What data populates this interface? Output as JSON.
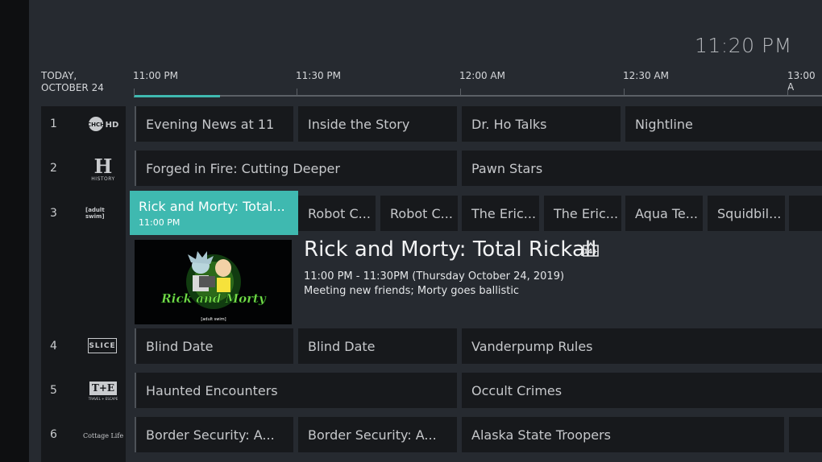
{
  "clock": "11:20 PM",
  "date": {
    "line1": "TODAY,",
    "line2": "OCTOBER 24"
  },
  "times": [
    "11:00 PM",
    "11:30 PM",
    "12:00 AM",
    "12:30 AM",
    "13:00 A"
  ],
  "channels": [
    {
      "number": "1",
      "logo": "CHCH HD",
      "logo_icon": "chch-hd-logo-icon"
    },
    {
      "number": "2",
      "logo": "HISTORY",
      "logo_mark": "H",
      "logo_icon": "history-logo-icon"
    },
    {
      "number": "3",
      "logo": "[adult swim]",
      "logo_icon": "adult-swim-logo-icon"
    },
    {
      "number": "4",
      "logo": "SLICE",
      "logo_icon": "slice-logo-icon"
    },
    {
      "number": "5",
      "logo": "T+E",
      "logo_sub": "TRAVEL + ESCAPE",
      "logo_icon": "travel-escape-logo-icon"
    },
    {
      "number": "6",
      "logo": "Cottage Life",
      "logo_icon": "cottage-life-logo-icon"
    }
  ],
  "programs": {
    "ch1": [
      "Evening News at 11",
      "Inside the Story",
      "Dr. Ho Talks",
      "Nightline"
    ],
    "ch2": [
      "Forged in Fire: Cutting Deeper",
      "Pawn Stars"
    ],
    "ch3": [
      "Rick and Morty: Total...",
      "Robot C...",
      "Robot C...",
      "The Eric...",
      "The Eric...",
      "Aqua Te...",
      "Squidbil...",
      ""
    ],
    "ch4": [
      "Blind Date",
      "Blind Date",
      "Vanderpump Rules"
    ],
    "ch5": [
      "Haunted Encounters",
      "Occult Crimes"
    ],
    "ch6": [
      "Border Security: A...",
      "Border Security: A...",
      "Alaska State Troopers",
      ""
    ]
  },
  "selected": {
    "short_title": "Rick and Morty: Total...",
    "start_time": "11:00 PM",
    "title": "Rick and Morty: Total Rickall",
    "rating": "14+",
    "time_range": "11:00 PM - 11:30PM (Thursday October 24, 2019)",
    "description": "Meeting new friends; Morty goes ballistic",
    "thumbnail_title": "Rick and Morty",
    "thumbnail_brand": "[adult swim]"
  },
  "timeline_progress": 0.22
}
